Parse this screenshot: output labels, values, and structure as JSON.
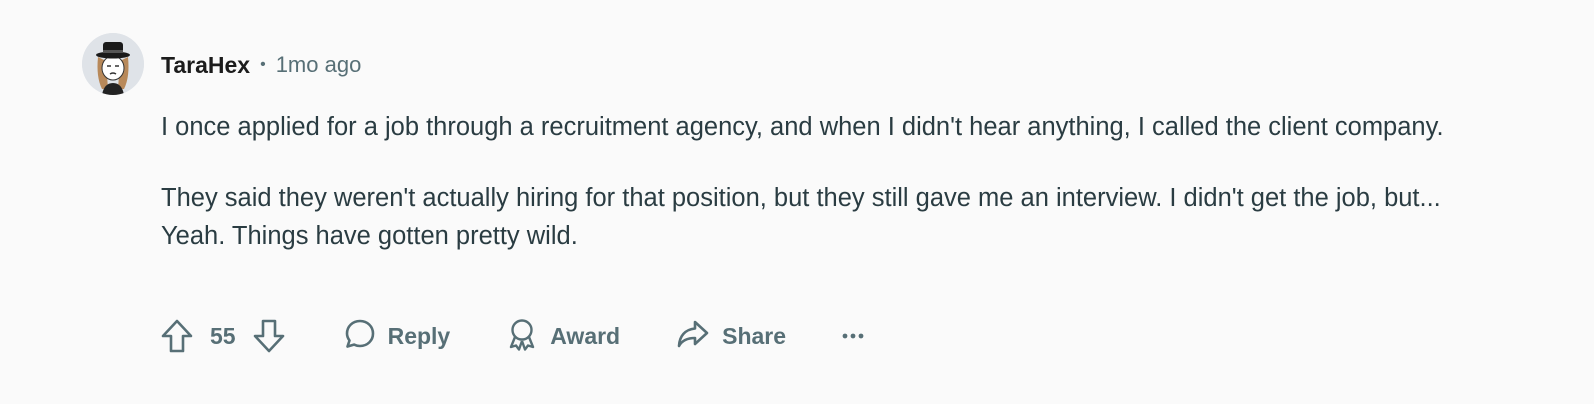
{
  "comment": {
    "author": "TaraHex",
    "separator": "•",
    "timestamp": "1mo ago",
    "paragraphs": [
      "I once applied for a job through a recruitment agency, and when I didn't hear anything, I called the client company.",
      "They said they weren't actually hiring for that position, but they still gave me an interview. I didn't get the job, but... Yeah. Things have gotten pretty wild."
    ]
  },
  "actions": {
    "vote_count": "55",
    "reply_label": "Reply",
    "award_label": "Award",
    "share_label": "Share",
    "more_label": "•••"
  },
  "icons": {
    "upvote": "arrow-up-outline",
    "downvote": "arrow-down-outline",
    "reply": "speech-bubble",
    "award": "award-ribbon",
    "share": "share-arrow",
    "more": "horizontal-ellipsis"
  },
  "colors": {
    "background": "#fafafa",
    "text_primary": "#1c1c1c",
    "text_body": "#2a3c42",
    "text_meta": "#576f76"
  }
}
